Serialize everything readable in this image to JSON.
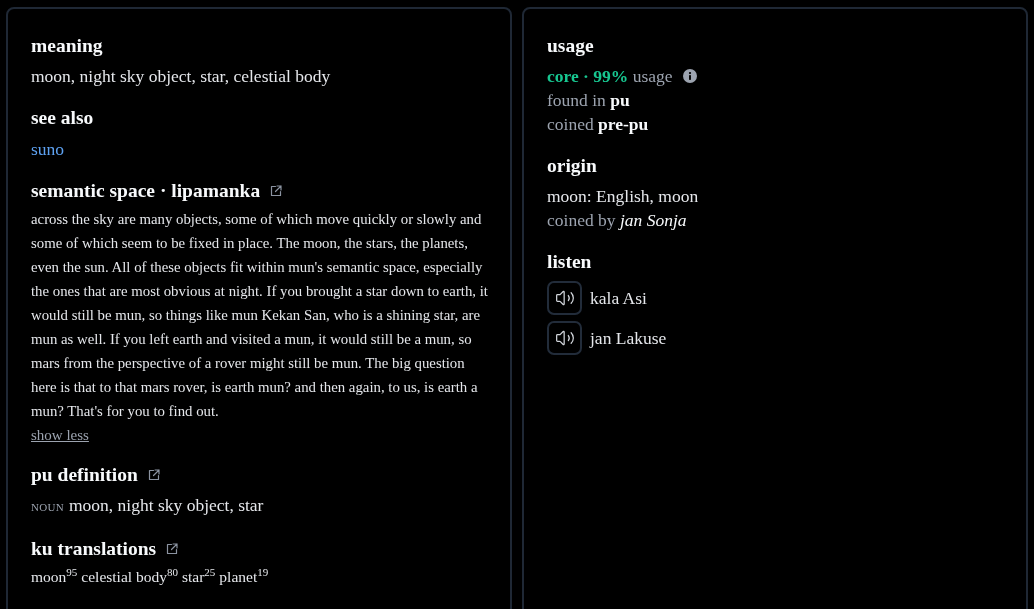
{
  "definition_panel": {
    "meaning": {
      "heading": "meaning",
      "text": "moon, night sky object, star, celestial body"
    },
    "see_also": {
      "heading": "see also",
      "links": [
        "suno"
      ]
    },
    "semantic_space": {
      "heading": "semantic space · lipamanka",
      "external_link": true,
      "text": "across the sky are many objects, some of which move quickly or slowly and some of which seem to be fixed in place. The moon, the stars, the planets, even the sun. All of these objects fit within mun's semantic space, especially the ones that are most obvious at night. If you brought a star down to earth, it would still be mun, so things like mun Kekan San, who is a shining star, are mun as well. If you left earth and visited a mun, it would still be a mun, so mars from the perspective of a rover might still be mun. The big question here is that to that mars rover, is earth mun? and then again, to us, is earth a mun? That's for you to find out.",
      "toggle": "show less"
    },
    "pu_definition": {
      "heading": "pu definition",
      "external_link": true,
      "entries": [
        {
          "part_of_speech": "NOUN",
          "text": "moon, night sky object, star"
        }
      ]
    },
    "ku_translations": {
      "heading": "ku translations",
      "external_link": true,
      "items": [
        {
          "word": "moon",
          "score": "95"
        },
        {
          "word": "celestial body",
          "score": "80"
        },
        {
          "word": "star",
          "score": "25"
        },
        {
          "word": "planet",
          "score": "19"
        }
      ]
    }
  },
  "info_panel": {
    "usage": {
      "heading": "usage",
      "category": "core · 99%",
      "category_suffix": "usage",
      "found_in": "found in **pu**",
      "coined": "coined **pre-pu**"
    },
    "origin": {
      "heading": "origin",
      "etymology": "moon: English, moon",
      "credit": "coined by *jan Sonja*"
    },
    "listen": {
      "heading": "listen",
      "recordings": [
        {
          "speaker": "kala Asi"
        },
        {
          "speaker": "jan Lakuse"
        }
      ]
    }
  }
}
